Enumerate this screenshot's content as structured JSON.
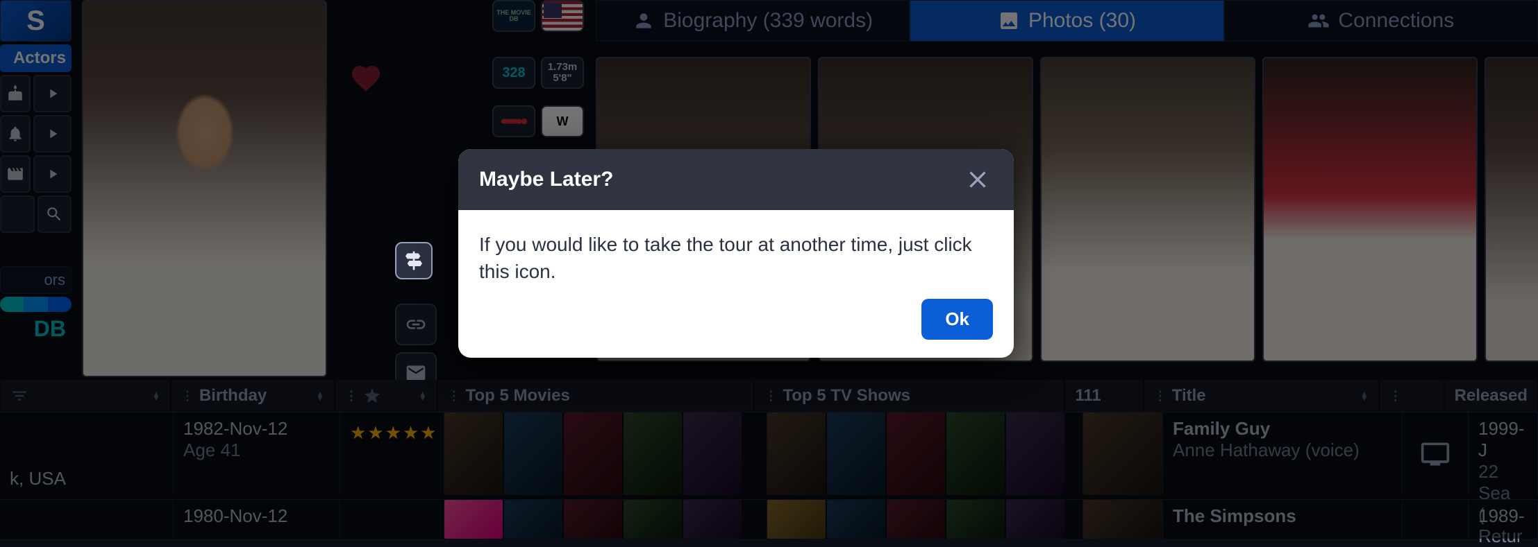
{
  "sidebar": {
    "logo_text": "S",
    "actors_label": "Actors",
    "ors_label": "ors",
    "db_label": "DB"
  },
  "badges": {
    "id": "328",
    "height_m": "1.73m",
    "height_ft": "5'8\"",
    "tmdb_top": "THE MOVIE",
    "tmdb_bot": "DB",
    "wiki": "W"
  },
  "tabs": {
    "bio": "Biography (339 words)",
    "photos": "Photos (30)",
    "connections": "Connections"
  },
  "columns": {
    "birthday": "Birthday",
    "top_movies": "Top 5 Movies",
    "top_tv": "Top 5 TV Shows",
    "count": "111",
    "title": "Title",
    "released": "Released"
  },
  "rows": [
    {
      "birthday": "1982-Nov-12",
      "age": "Age 41",
      "location": "k, USA",
      "title": "Family Guy",
      "subtitle": "Anne Hathaway (voice)",
      "released": "1999-J",
      "released_sub1": "22 Sea",
      "released_sub2": "( Retur"
    },
    {
      "birthday": "1980-Nov-12",
      "title": "The Simpsons",
      "released": "1989-"
    }
  ],
  "popover": {
    "title": "Maybe Later?",
    "body": "If you would like to take the tour at another time, just click this icon.",
    "ok": "Ok"
  }
}
